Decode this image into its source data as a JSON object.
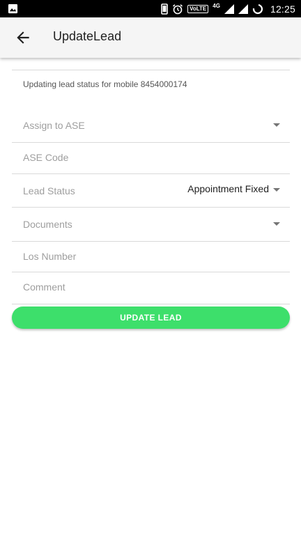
{
  "status_bar": {
    "network_type": "4G",
    "volte_label": "VoLTE",
    "time": "12:25",
    "icons": [
      "image-icon",
      "phone-icon",
      "alarm-icon",
      "signal-icon",
      "signal-icon",
      "battery-icon"
    ]
  },
  "app_bar": {
    "title": "UpdateLead",
    "back_icon": "back-arrow-icon"
  },
  "form": {
    "subtitle": "Updating lead status for mobile 8454000174",
    "assign_to_ase": {
      "label": "Assign to ASE",
      "value": ""
    },
    "ase_code": {
      "placeholder": "ASE Code",
      "value": ""
    },
    "lead_status": {
      "label": "Lead Status",
      "value": "Appointment Fixed"
    },
    "documents": {
      "label": "Documents",
      "value": ""
    },
    "los_number": {
      "placeholder": "Los Number",
      "value": ""
    },
    "comment": {
      "placeholder": "Comment",
      "value": ""
    },
    "submit_label": "UPDATE LEAD"
  },
  "colors": {
    "accent": "#3ddf6b",
    "status_bar": "#000000",
    "app_bar": "#f5f5f5"
  }
}
